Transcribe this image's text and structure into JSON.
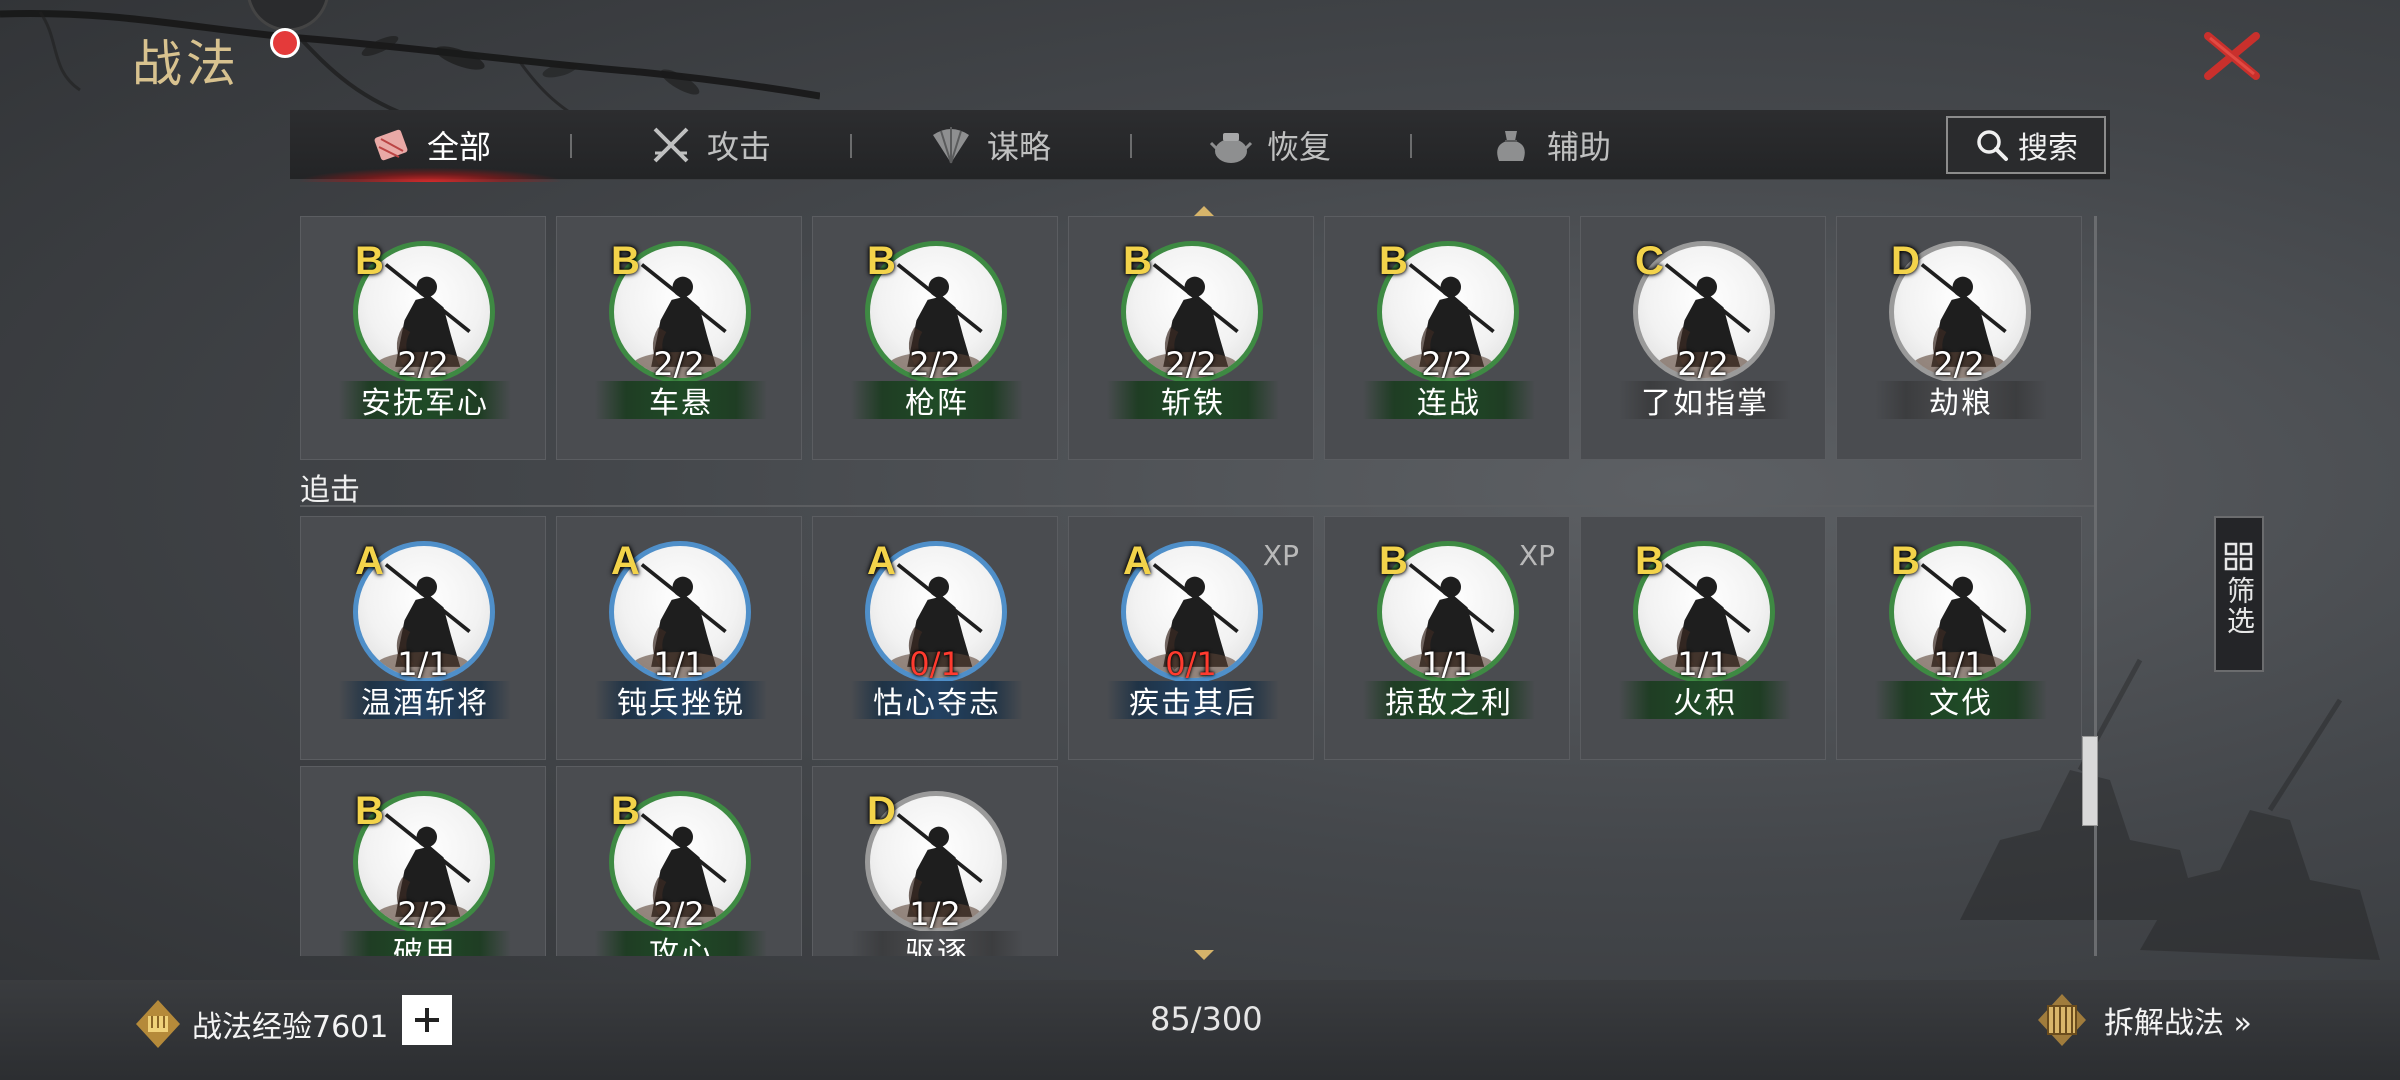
{
  "title": "战法",
  "tabs": [
    {
      "label": "全部",
      "icon": "all-skills-icon",
      "active": true
    },
    {
      "label": "攻击",
      "icon": "crossed-swords-icon",
      "active": false
    },
    {
      "label": "谋略",
      "icon": "fan-strategy-icon",
      "active": false
    },
    {
      "label": "恢复",
      "icon": "restore-pot-icon",
      "active": false
    },
    {
      "label": "辅助",
      "icon": "support-bag-icon",
      "active": false
    }
  ],
  "search": {
    "label": "搜索"
  },
  "filter": {
    "label": "筛选"
  },
  "section_label": "追击",
  "row1": [
    {
      "grade": "B",
      "count": "2/2",
      "name": "安抚军心"
    },
    {
      "grade": "B",
      "count": "2/2",
      "name": "车悬"
    },
    {
      "grade": "B",
      "count": "2/2",
      "name": "枪阵"
    },
    {
      "grade": "B",
      "count": "2/2",
      "name": "斩铁"
    },
    {
      "grade": "B",
      "count": "2/2",
      "name": "连战"
    },
    {
      "grade": "C",
      "count": "2/2",
      "name": "了如指掌"
    },
    {
      "grade": "D",
      "count": "2/2",
      "name": "劫粮"
    }
  ],
  "row2": [
    {
      "grade": "A",
      "count": "1/1",
      "name": "温酒斩将",
      "xp": ""
    },
    {
      "grade": "A",
      "count": "1/1",
      "name": "钝兵挫锐",
      "xp": ""
    },
    {
      "grade": "A",
      "count": "0/1",
      "name": "怙心夺志",
      "xp": ""
    },
    {
      "grade": "A",
      "count": "0/1",
      "name": "疾击其后",
      "xp": "XP"
    },
    {
      "grade": "B",
      "count": "1/1",
      "name": "掠敌之利",
      "xp": "XP"
    },
    {
      "grade": "B",
      "count": "1/1",
      "name": "火积",
      "xp": ""
    },
    {
      "grade": "B",
      "count": "1/1",
      "name": "文伐",
      "xp": ""
    }
  ],
  "row3": [
    {
      "grade": "B",
      "count": "2/2",
      "name": "破甲"
    },
    {
      "grade": "B",
      "count": "2/2",
      "name": "攻心"
    },
    {
      "grade": "D",
      "count": "1/2",
      "name": "驱逐"
    }
  ],
  "footer": {
    "exp_label": "战法经验7601",
    "capacity": "85/300",
    "dismantle_label": "拆解战法 »"
  },
  "colors": {
    "grade_text": "#f3d34a",
    "ring_A": "#4f8fc9",
    "ring_B": "#3e8a43",
    "ring_CD": "#9a9a9a",
    "count_empty": "#ff3b2f",
    "close_x": "#c9302c",
    "active_tab_glow": "#dc2828"
  }
}
